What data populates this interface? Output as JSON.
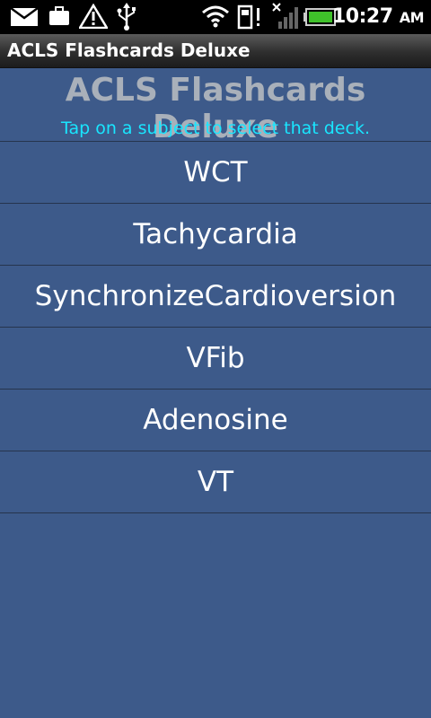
{
  "status_bar": {
    "time": "10:27",
    "ampm": "AM",
    "icons": [
      "mail-icon",
      "briefcase-icon",
      "warning-icon",
      "usb-icon",
      "wifi-icon",
      "sd-card-icon",
      "signal-icon",
      "battery-icon"
    ],
    "battery_color": "#3fc12a"
  },
  "title_bar": {
    "title": "ACLS Flashcards Deluxe"
  },
  "main": {
    "heading": "ACLS Flashcards Deluxe",
    "subtitle": "Tap on a subject to select that deck.",
    "decks": [
      {
        "label": "WCT"
      },
      {
        "label": "Tachycardia"
      },
      {
        "label": "SynchronizeCardioversion"
      },
      {
        "label": "VFib"
      },
      {
        "label": "Adenosine"
      },
      {
        "label": "VT"
      }
    ]
  },
  "colors": {
    "background": "#3d5a8a",
    "subtitle": "#19e6ff",
    "heading": "#a9b0ba"
  }
}
